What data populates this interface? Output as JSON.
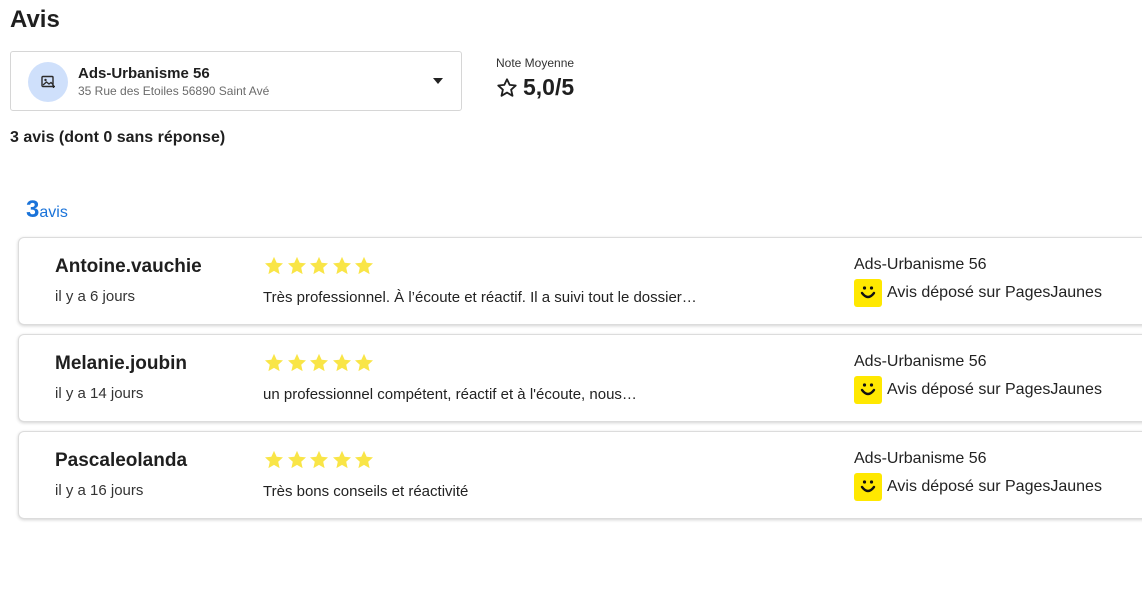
{
  "page": {
    "title": "Avis"
  },
  "location": {
    "name": "Ads-Urbanisme 56",
    "address": "35 Rue des Etoiles 56890 Saint Avé",
    "avatar_icon": "image-icon",
    "dropdown_icon": "caret-down-icon"
  },
  "rating": {
    "label": "Note Moyenne",
    "value": "5,0/5",
    "icon": "star-outline-icon"
  },
  "summary": "3 avis (dont 0 sans réponse)",
  "count": {
    "number": "3",
    "label": "avis"
  },
  "colors": {
    "accent": "#1a73d9",
    "star": "#f9e547",
    "pagesjaunes": "#ffe800"
  },
  "reviews": [
    {
      "author": "Antoine.vauchie",
      "date": "il y a 6 jours",
      "rating": 5,
      "text": "Très professionnel. À l’écoute et réactif. Il a suivi tout le dossier…",
      "business": "Ads-Urbanisme 56",
      "source": "Avis déposé sur PagesJaunes"
    },
    {
      "author": "Melanie.joubin",
      "date": "il y a 14 jours",
      "rating": 5,
      "text": "un professionnel compétent, réactif et à l'écoute, nous…",
      "business": "Ads-Urbanisme 56",
      "source": "Avis déposé sur PagesJaunes"
    },
    {
      "author": "Pascaleolanda",
      "date": "il y a 16 jours",
      "rating": 5,
      "text": "Très bons conseils et réactivité",
      "business": "Ads-Urbanisme 56",
      "source": "Avis déposé sur PagesJaunes"
    }
  ]
}
